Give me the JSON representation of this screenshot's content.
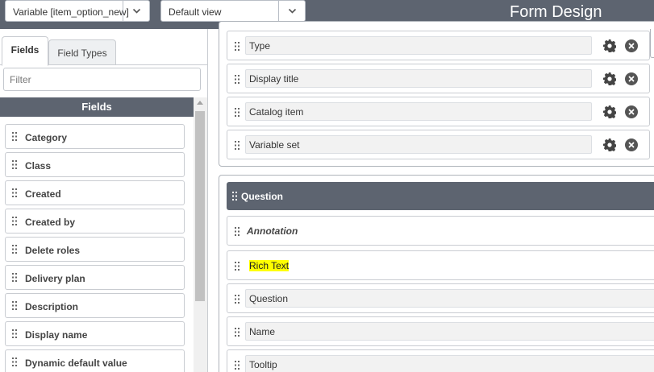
{
  "header": {
    "variable_select": "Variable [item_option_new]",
    "view_select": "Default view",
    "title": "Form Design"
  },
  "left_panel": {
    "tabs": [
      {
        "label": "Fields",
        "active": true
      },
      {
        "label": "Field Types",
        "active": false
      }
    ],
    "filter_placeholder": "Filter",
    "list_header": "Fields",
    "fields": [
      "Category",
      "Class",
      "Created",
      "Created by",
      "Delete roles",
      "Delivery plan",
      "Description",
      "Display name",
      "Dynamic default value"
    ]
  },
  "form": {
    "section1_rows": [
      "Type",
      "Display title",
      "Catalog item",
      "Variable set"
    ],
    "section2": {
      "header": "Question",
      "annotation_label": "Annotation",
      "rich_text_label": "Rich Text",
      "rows": [
        "Question",
        "Name",
        "Tooltip"
      ]
    }
  },
  "colors": {
    "header_bg": "#5d6470",
    "highlight": "#ffff00"
  },
  "icons": [
    "chevron-down-icon",
    "drag-handle-icon",
    "gear-icon",
    "close-icon"
  ]
}
